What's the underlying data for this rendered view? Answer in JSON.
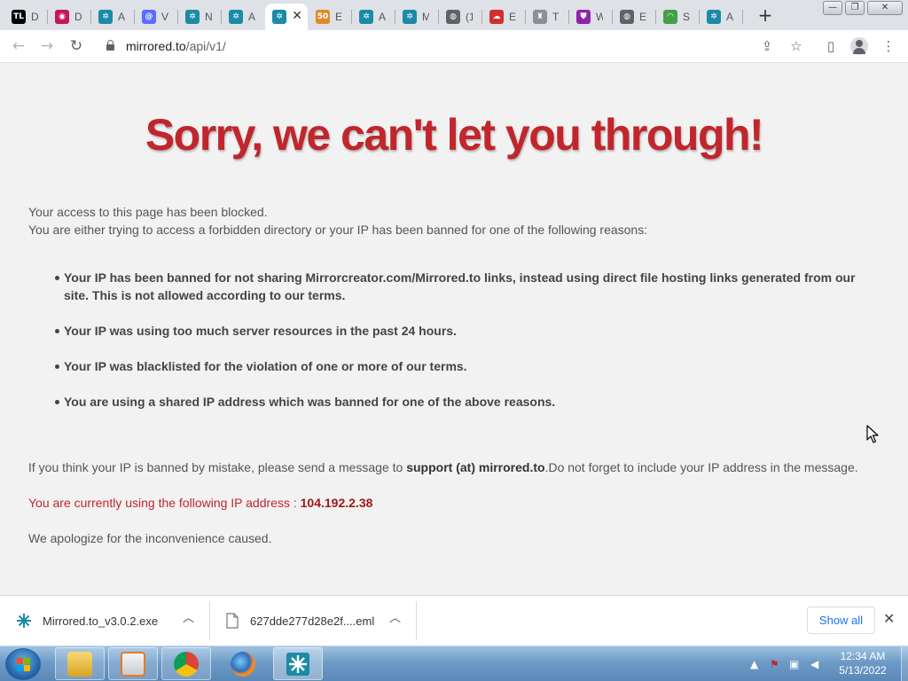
{
  "browser": {
    "tabs": [
      {
        "favicon": "tl-icon",
        "label": "D",
        "color": "#000000",
        "glyph": "TL"
      },
      {
        "favicon": "camera-icon",
        "label": "D",
        "color": "#c2185b",
        "glyph": "◉"
      },
      {
        "favicon": "mirrored-icon",
        "label": "A",
        "color": "#1b8ba6",
        "glyph": "✲"
      },
      {
        "favicon": "at-icon",
        "label": "V",
        "color": "#5b6cff",
        "glyph": "@"
      },
      {
        "favicon": "mirrored-icon",
        "label": "N",
        "color": "#1b8ba6",
        "glyph": "✲"
      },
      {
        "favicon": "mirrored-icon",
        "label": "A",
        "color": "#1b8ba6",
        "glyph": "✲"
      },
      {
        "favicon": "mirrored-icon",
        "label": "",
        "color": "#1b8ba6",
        "glyph": "✲",
        "active": true
      },
      {
        "favicon": "fifty-icon",
        "label": "E",
        "color": "#e0892b",
        "glyph": "50"
      },
      {
        "favicon": "mirrored-icon",
        "label": "A",
        "color": "#1b8ba6",
        "glyph": "✲"
      },
      {
        "favicon": "mirrored-icon",
        "label": "M",
        "color": "#1b8ba6",
        "glyph": "✲"
      },
      {
        "favicon": "globe-icon",
        "label": "(1",
        "color": "#5f6368",
        "glyph": "◍"
      },
      {
        "favicon": "cloud-icon",
        "label": "E",
        "color": "#d32f2f",
        "glyph": "☁"
      },
      {
        "favicon": "castle-icon",
        "label": "T",
        "color": "#8a8f96",
        "glyph": "♜"
      },
      {
        "favicon": "shield-icon",
        "label": "W",
        "color": "#8e24aa",
        "glyph": "⛊"
      },
      {
        "favicon": "globe-icon",
        "label": "E",
        "color": "#5f6368",
        "glyph": "◍"
      },
      {
        "favicon": "wifi-icon",
        "label": "S",
        "color": "#43a047",
        "glyph": "◠"
      },
      {
        "favicon": "mirrored-icon",
        "label": "A",
        "color": "#1b8ba6",
        "glyph": "✲"
      }
    ],
    "url_host": "mirrored.to",
    "url_path": "/api/v1/"
  },
  "page": {
    "headline": "Sorry, we can't let you through!",
    "intro_line1": "Your access to this page has been blocked.",
    "intro_line2": "You are either trying to access a forbidden directory or your IP has been banned for one of the following reasons:",
    "reasons": [
      "Your IP has been banned for not sharing Mirrorcreator.com/Mirrored.to links, instead using direct file hosting links generated from our site. This is not allowed according to our terms.",
      "Your IP was using too much server resources in the past 24 hours.",
      "Your IP was blacklisted for the violation of one or more of our terms.",
      "You are using a shared IP address which was banned for one of the above reasons."
    ],
    "mistake_prefix": "If you think your IP is banned by mistake, please send a message to ",
    "support_email": "support (at) mirrored.to",
    "mistake_suffix": ".Do not forget to include your IP address in the message.",
    "ip_prefix": "You are currently using the following IP address : ",
    "ip_address": "104.192.2.38",
    "apology": "We apologize for the inconvenience caused.",
    "headline_color": "#c0262c"
  },
  "downloads": {
    "items": [
      {
        "name": "Mirrored.to_v3.0.2.exe",
        "icon": "mirrored-icon"
      },
      {
        "name": "627dde277d28e2f....eml",
        "icon": "file-icon"
      }
    ],
    "show_all": "Show all"
  },
  "taskbar": {
    "time": "12:34 AM",
    "date": "5/13/2022"
  }
}
